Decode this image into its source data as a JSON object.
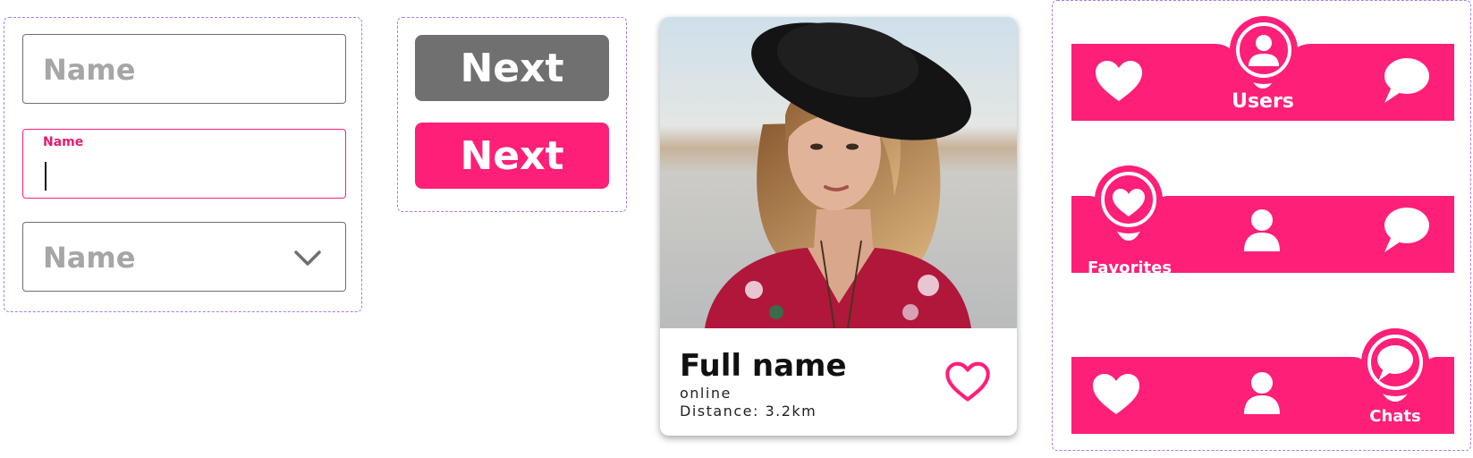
{
  "inputs": {
    "default": {
      "placeholder": "Name"
    },
    "focused": {
      "floating_label": "Name"
    },
    "select": {
      "placeholder": "Name"
    }
  },
  "buttons": {
    "disabled_label": "Next",
    "active_label": "Next"
  },
  "profile_card": {
    "name": "Full name",
    "status": "online",
    "distance": "Distance: 3.2km"
  },
  "nav_bars": [
    {
      "active": "Users",
      "label": "Users"
    },
    {
      "active": "Favorites",
      "label": "Favorites"
    },
    {
      "active": "Chats",
      "label": "Chats"
    }
  ],
  "colors": {
    "accent": "#fe1f78",
    "disabled": "#707070",
    "dashed_border": "#a77bf3",
    "placeholder": "#a6a6a6"
  },
  "icons": [
    "heart-icon",
    "user-icon",
    "chat-icon",
    "chevron-down-icon",
    "heart-outline-icon"
  ]
}
